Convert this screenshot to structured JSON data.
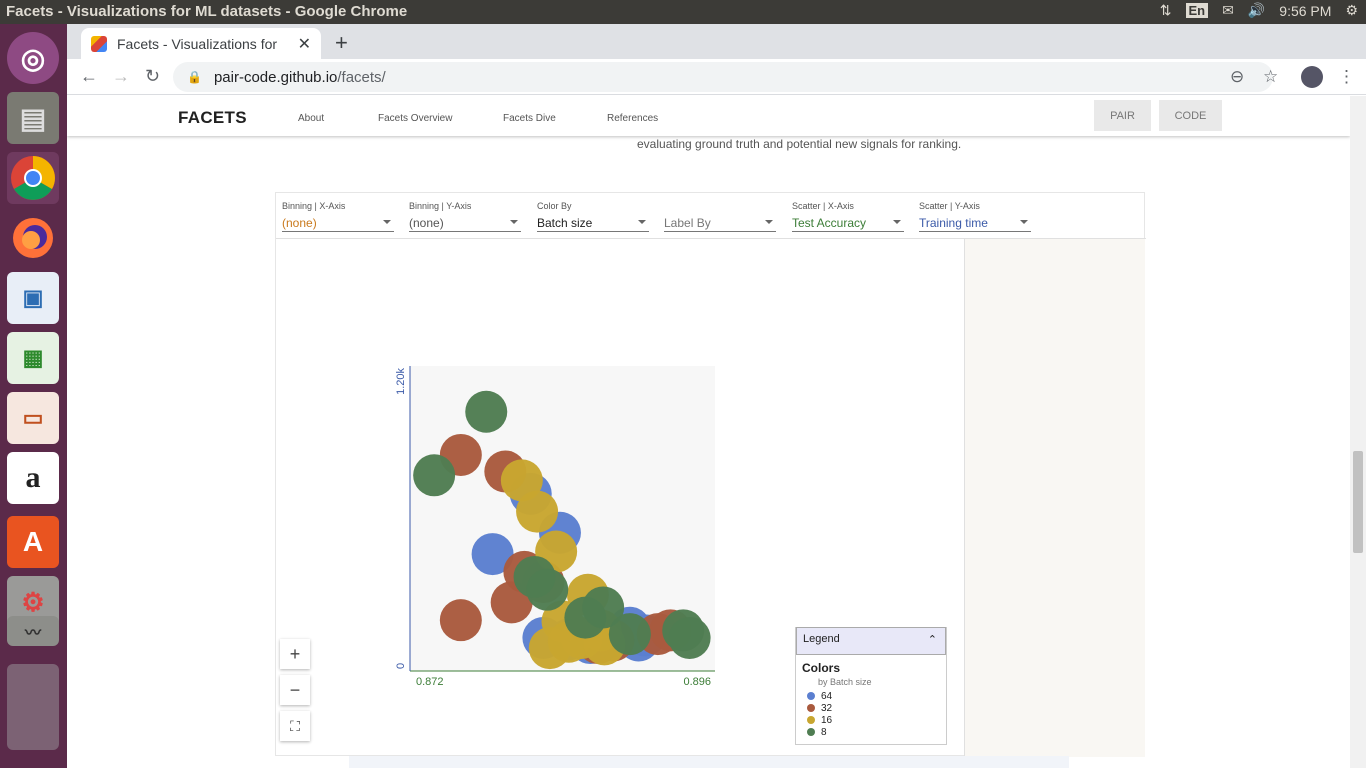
{
  "os": {
    "window_title": "Facets - Visualizations for ML datasets - Google Chrome",
    "keyboard": "En",
    "clock": "9:56 PM"
  },
  "browser": {
    "tab_title": "Facets - Visualizations for",
    "url_host": "pair-code.github.io",
    "url_path": "/facets/"
  },
  "site": {
    "brand": "FACETS",
    "nav": [
      "About",
      "Facets Overview",
      "Facets Dive",
      "References"
    ],
    "buttons": [
      "PAIR",
      "CODE"
    ],
    "description_fragment": "evaluating ground truth and potential new signals for ranking."
  },
  "controls": [
    {
      "label": "Binning | X-Axis",
      "value": "(none)",
      "color": "#c9791c"
    },
    {
      "label": "Binning | Y-Axis",
      "value": "(none)",
      "color": "#555555"
    },
    {
      "label": "Color By",
      "value": "Batch size",
      "color": "#222222"
    },
    {
      "label": "",
      "value": "Label By",
      "color": "#777777"
    },
    {
      "label": "Scatter | X-Axis",
      "value": "Test Accuracy",
      "color": "#3c7d37"
    },
    {
      "label": "Scatter | Y-Axis",
      "value": "Training time",
      "color": "#3b5aa8"
    }
  ],
  "legend": {
    "header": "Legend",
    "title": "Colors",
    "subtitle": "by Batch size",
    "entries": [
      {
        "label": "64",
        "color": "#5b7fd0"
      },
      {
        "label": "32",
        "color": "#a95a3e"
      },
      {
        "label": "16",
        "color": "#c8a630"
      },
      {
        "label": "8",
        "color": "#4f7d52"
      }
    ]
  },
  "chart_data": {
    "type": "scatter",
    "xlabel": "Test Accuracy",
    "ylabel": "Training time",
    "xlim": [
      0.872,
      0.896
    ],
    "ylim": [
      0,
      1200
    ],
    "x_tick_labels": [
      "0.872",
      "0.896"
    ],
    "y_tick_labels": [
      "0",
      "1.20k"
    ],
    "series": [
      {
        "name": "64",
        "color": "#5b7fd0",
        "points": [
          [
            0.8815,
            697
          ],
          [
            0.8785,
            460
          ],
          [
            0.8838,
            544
          ],
          [
            0.8825,
            130
          ],
          [
            0.8845,
            125
          ],
          [
            0.8885,
            135
          ],
          [
            0.8862,
            110
          ],
          [
            0.89,
            120
          ],
          [
            0.8893,
            170
          ],
          [
            0.8905,
            140
          ]
        ]
      },
      {
        "name": "32",
        "color": "#a95a3e",
        "points": [
          [
            0.876,
            850
          ],
          [
            0.8795,
            785
          ],
          [
            0.88,
            270
          ],
          [
            0.881,
            390
          ],
          [
            0.8825,
            350
          ],
          [
            0.8868,
            110
          ],
          [
            0.888,
            120
          ],
          [
            0.8925,
            160
          ],
          [
            0.876,
            200
          ],
          [
            0.8915,
            145
          ]
        ]
      },
      {
        "name": "16",
        "color": "#c8a630",
        "points": [
          [
            0.8808,
            750
          ],
          [
            0.882,
            627
          ],
          [
            0.8835,
            470
          ],
          [
            0.886,
            300
          ],
          [
            0.884,
            195
          ],
          [
            0.8855,
            130
          ],
          [
            0.887,
            160
          ],
          [
            0.883,
            90
          ],
          [
            0.8845,
            115
          ],
          [
            0.8873,
            105
          ]
        ]
      },
      {
        "name": "8",
        "color": "#4f7d52",
        "points": [
          [
            0.878,
            1020
          ],
          [
            0.8739,
            770
          ],
          [
            0.8818,
            370
          ],
          [
            0.8828,
            320
          ],
          [
            0.8858,
            210
          ],
          [
            0.8872,
            250
          ],
          [
            0.8935,
            160
          ],
          [
            0.894,
            130
          ],
          [
            0.8893,
            145
          ]
        ]
      }
    ]
  }
}
